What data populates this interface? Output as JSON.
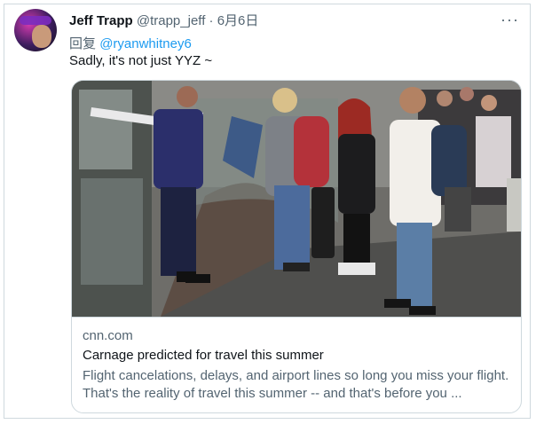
{
  "tweet": {
    "author_name": "Jeff Trapp",
    "author_handle": "@trapp_jeff",
    "separator": "·",
    "date": "6月6日",
    "more": "···",
    "reply_prefix": "回复",
    "reply_mention": "@ryanwhitney6",
    "text": "Sadly, it's not just YYZ ~"
  },
  "card": {
    "domain": "cnn.com",
    "title": "Carnage predicted for travel this summer",
    "description": "Flight cancelations, delays, and airport lines so long you miss your flight. That's the reality of travel this summer -- and that's before you ..."
  },
  "colors": {
    "link": "#1d9bf0",
    "secondary_text": "#536471",
    "border": "#cfd9de"
  },
  "icons": {
    "more": "more-options-icon"
  }
}
